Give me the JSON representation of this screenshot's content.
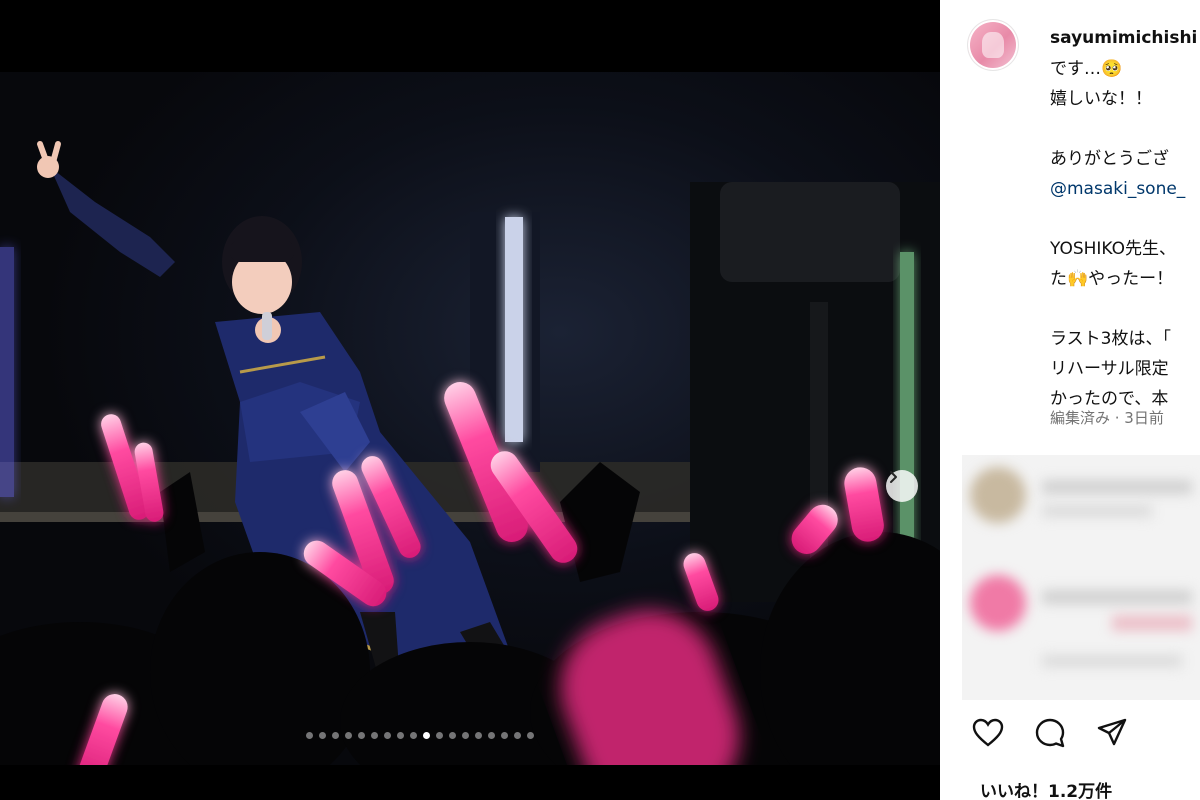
{
  "post": {
    "username": "sayumimichishi",
    "caption_lines": [
      "です…🥺",
      "嬉しいな！！",
      "",
      "ありがとうござ",
      "@masaki_sone_",
      "",
      "YOSHIKO先生、",
      "た🙌やったー！",
      "",
      "ラスト3枚は、「",
      "リハーサル限定",
      "かったので、本"
    ],
    "edited_label": "編集済み · 3日前",
    "likes_label": "いいね！1.2万件"
  },
  "carousel": {
    "total": 18,
    "active_index": 9
  },
  "icons": {
    "like": "heart-icon",
    "comment": "comment-icon",
    "share": "share-icon",
    "next": "chevron-right-icon"
  },
  "colors": {
    "glowstick": "#ff2f8e",
    "mention": "#00376b"
  }
}
